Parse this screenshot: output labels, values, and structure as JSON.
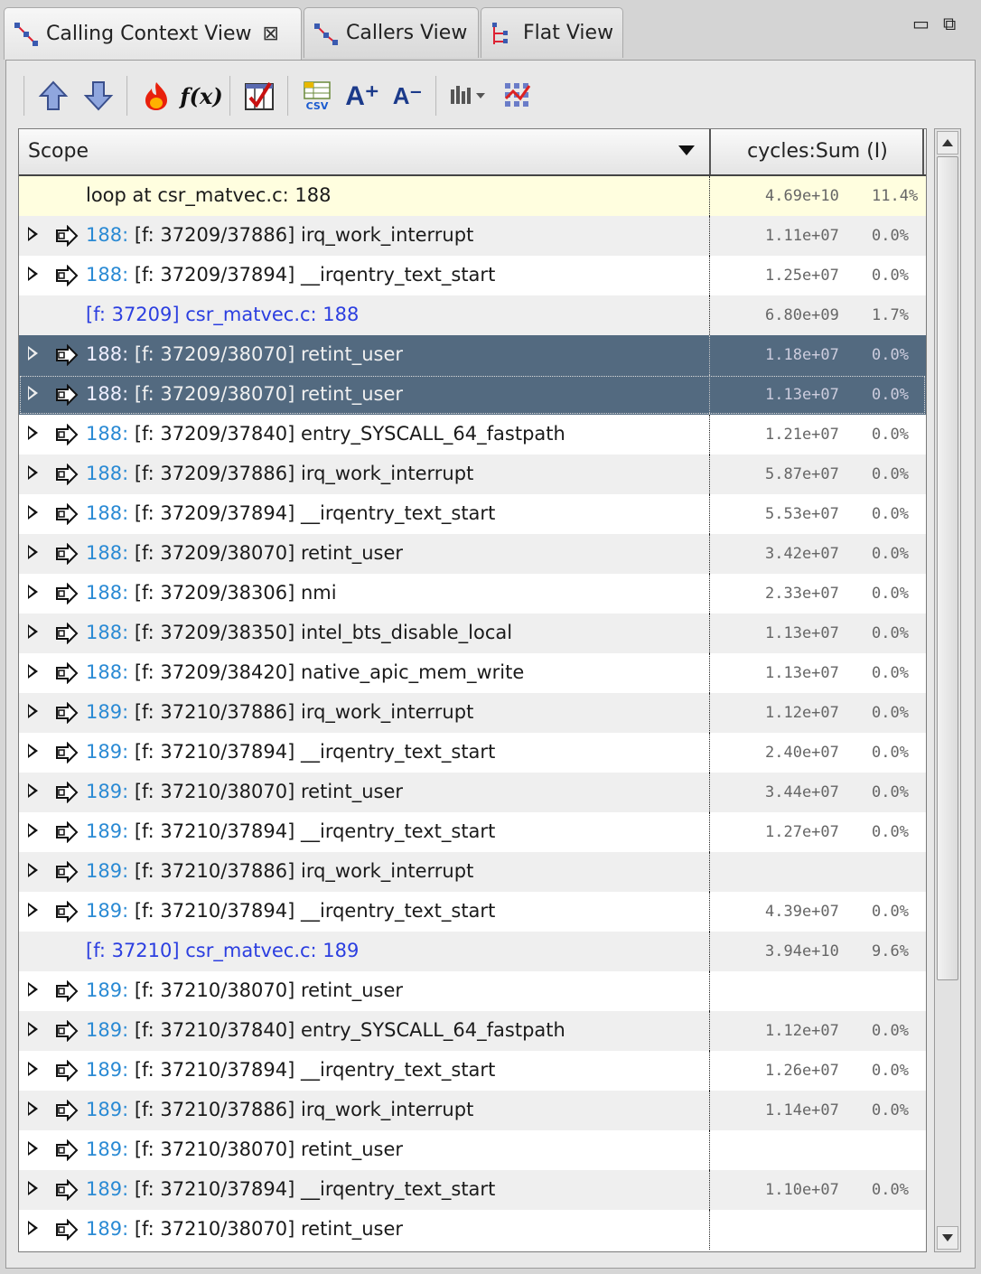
{
  "tabs": [
    {
      "label": "Calling Context View",
      "active": true,
      "close": "⊠"
    },
    {
      "label": "Callers View",
      "active": false
    },
    {
      "label": "Flat View",
      "active": false
    }
  ],
  "window_controls": {
    "minimize": "▭",
    "restore": "⧉"
  },
  "toolbar": {
    "icons": [
      "up-arrow-icon",
      "down-arrow-icon",
      "hot-path-flame-icon",
      "derived-metric-fx-icon",
      "column-check-icon",
      "csv-export-icon",
      "font-increase-icon",
      "font-decrease-icon",
      "graph-dropdown-icon",
      "show-metrics-icon"
    ],
    "fx_label": "f(x)",
    "csv_label": "CSV",
    "font_up_label": "A⁺",
    "font_down_label": "A⁻"
  },
  "table": {
    "col_scope": "Scope",
    "col_metric": "cycles:Sum (I)",
    "rows": [
      {
        "type": "loop",
        "text": "loop at csr_matvec.c: 188",
        "value": "4.69e+10",
        "pct": "11.4%"
      },
      {
        "type": "call",
        "line": "188:",
        "rest": " [f: 37209/37886] irq_work_interrupt",
        "value": "1.11e+07",
        "pct": "0.0%"
      },
      {
        "type": "call",
        "line": "188:",
        "rest": " [f: 37209/37894] __irqentry_text_start",
        "value": "1.25e+07",
        "pct": "0.0%"
      },
      {
        "type": "stmt",
        "text": "[f: 37209] csr_matvec.c: 188",
        "value": "6.80e+09",
        "pct": "1.7%"
      },
      {
        "type": "call",
        "line": "188:",
        "rest": " [f: 37209/38070] retint_user",
        "value": "1.18e+07",
        "pct": "0.0%",
        "selected": true
      },
      {
        "type": "call",
        "line": "188:",
        "rest": " [f: 37209/38070] retint_user",
        "value": "1.13e+07",
        "pct": "0.0%",
        "selected": true
      },
      {
        "type": "call",
        "line": "188:",
        "rest": " [f: 37209/37840] entry_SYSCALL_64_fastpath",
        "value": "1.21e+07",
        "pct": "0.0%"
      },
      {
        "type": "call",
        "line": "188:",
        "rest": " [f: 37209/37886] irq_work_interrupt",
        "value": "5.87e+07",
        "pct": "0.0%"
      },
      {
        "type": "call",
        "line": "188:",
        "rest": " [f: 37209/37894] __irqentry_text_start",
        "value": "5.53e+07",
        "pct": "0.0%"
      },
      {
        "type": "call",
        "line": "188:",
        "rest": " [f: 37209/38070] retint_user",
        "value": "3.42e+07",
        "pct": "0.0%"
      },
      {
        "type": "call",
        "line": "188:",
        "rest": " [f: 37209/38306] nmi",
        "value": "2.33e+07",
        "pct": "0.0%"
      },
      {
        "type": "call",
        "line": "188:",
        "rest": " [f: 37209/38350] intel_bts_disable_local",
        "value": "1.13e+07",
        "pct": "0.0%"
      },
      {
        "type": "call",
        "line": "188:",
        "rest": " [f: 37209/38420] native_apic_mem_write",
        "value": "1.13e+07",
        "pct": "0.0%"
      },
      {
        "type": "call",
        "line": "189:",
        "rest": " [f: 37210/37886] irq_work_interrupt",
        "value": "1.12e+07",
        "pct": "0.0%"
      },
      {
        "type": "call",
        "line": "189:",
        "rest": " [f: 37210/37894] __irqentry_text_start",
        "value": "2.40e+07",
        "pct": "0.0%"
      },
      {
        "type": "call",
        "line": "189:",
        "rest": " [f: 37210/38070] retint_user",
        "value": "3.44e+07",
        "pct": "0.0%"
      },
      {
        "type": "call",
        "line": "189:",
        "rest": " [f: 37210/37894] __irqentry_text_start",
        "value": "1.27e+07",
        "pct": "0.0%"
      },
      {
        "type": "call",
        "line": "189:",
        "rest": " [f: 37210/37886] irq_work_interrupt",
        "value": "",
        "pct": ""
      },
      {
        "type": "call",
        "line": "189:",
        "rest": " [f: 37210/37894] __irqentry_text_start",
        "value": "4.39e+07",
        "pct": "0.0%"
      },
      {
        "type": "stmt",
        "text": "[f: 37210] csr_matvec.c: 189",
        "value": "3.94e+10",
        "pct": "9.6%"
      },
      {
        "type": "call",
        "line": "189:",
        "rest": " [f: 37210/38070] retint_user",
        "value": "",
        "pct": ""
      },
      {
        "type": "call",
        "line": "189:",
        "rest": " [f: 37210/37840] entry_SYSCALL_64_fastpath",
        "value": "1.12e+07",
        "pct": "0.0%"
      },
      {
        "type": "call",
        "line": "189:",
        "rest": " [f: 37210/37894] __irqentry_text_start",
        "value": "1.26e+07",
        "pct": "0.0%"
      },
      {
        "type": "call",
        "line": "189:",
        "rest": " [f: 37210/37886] irq_work_interrupt",
        "value": "1.14e+07",
        "pct": "0.0%"
      },
      {
        "type": "call",
        "line": "189:",
        "rest": " [f: 37210/38070] retint_user",
        "value": "",
        "pct": ""
      },
      {
        "type": "call",
        "line": "189:",
        "rest": " [f: 37210/37894] __irqentry_text_start",
        "value": "1.10e+07",
        "pct": "0.0%"
      },
      {
        "type": "call",
        "line": "189:",
        "rest": " [f: 37210/38070] retint_user",
        "value": "",
        "pct": ""
      }
    ]
  },
  "colors": {
    "selection": "#536a80",
    "highlight_row": "#fffedf",
    "link_blue": "#2a8ad4",
    "source_blue": "#2b3ee0"
  }
}
